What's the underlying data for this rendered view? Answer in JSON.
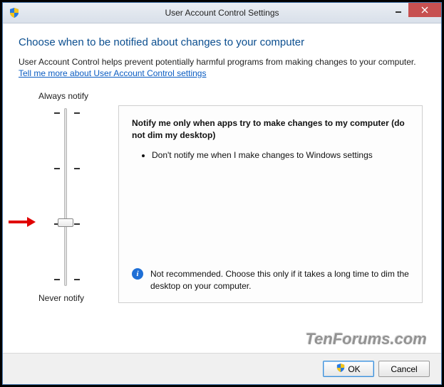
{
  "window": {
    "title": "User Account Control Settings"
  },
  "heading": "Choose when to be notified about changes to your computer",
  "subtext": "User Account Control helps prevent potentially harmful programs from making changes to your computer.",
  "help_link": "Tell me more about User Account Control settings",
  "slider": {
    "top_label": "Always notify",
    "bottom_label": "Never notify",
    "position": 2
  },
  "description": {
    "title": "Notify me only when apps try to make changes to my computer (do not dim my desktop)",
    "bullet": "Don't notify me when I make changes to Windows settings",
    "info": "Not recommended. Choose this only if it takes a long time to dim the desktop on your computer."
  },
  "buttons": {
    "ok": "OK",
    "cancel": "Cancel"
  },
  "watermark": "TenForums.com"
}
